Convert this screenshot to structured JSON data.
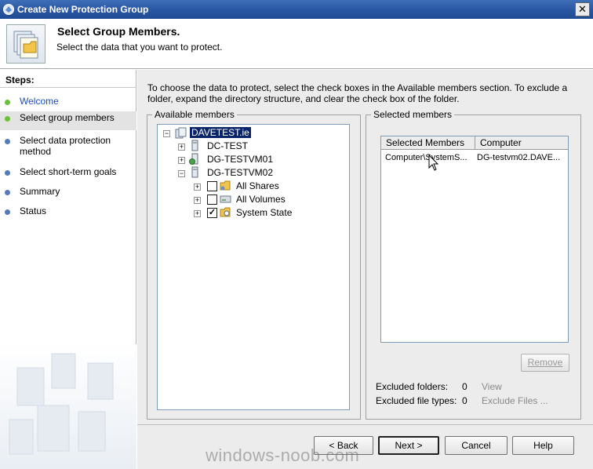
{
  "window": {
    "title": "Create New Protection Group",
    "close_glyph": "✕"
  },
  "header": {
    "title": "Select Group Members.",
    "subtitle": "Select the data that you want to protect."
  },
  "steps": {
    "title": "Steps:",
    "items": [
      {
        "label": "Welcome",
        "state": "link"
      },
      {
        "label": "Select group members",
        "state": "current"
      },
      {
        "label": "Select data protection method",
        "state": "pending"
      },
      {
        "label": "Select short-term goals",
        "state": "pending"
      },
      {
        "label": "Summary",
        "state": "pending"
      },
      {
        "label": "Status",
        "state": "pending"
      }
    ]
  },
  "instructions": "To choose the data to protect, select the check boxes in the Available members section. To exclude a folder, expand the directory structure, and clear the check box of the folder.",
  "available": {
    "title": "Available members",
    "tree": {
      "root": "DAVETEST.ie",
      "servers": [
        {
          "name": "DC-TEST"
        },
        {
          "name": "DG-TESTVM01"
        },
        {
          "name": "DG-TESTVM02"
        }
      ],
      "children_of_vm02": [
        {
          "name": "All Shares",
          "checked": false
        },
        {
          "name": "All Volumes",
          "checked": false
        },
        {
          "name": "System State",
          "checked": true
        }
      ]
    }
  },
  "selected": {
    "title": "Selected members",
    "columns": [
      "Selected Members",
      "Computer"
    ],
    "rows": [
      {
        "member": "Computer\\SystemS...",
        "computer": "DG-testvm02.DAVE..."
      }
    ],
    "remove_label": "Remove"
  },
  "exclusions": {
    "folders_label": "Excluded folders:",
    "folders_count": "0",
    "folders_link": "View",
    "filetypes_label": "Excluded file types:",
    "filetypes_count": "0",
    "filetypes_link": "Exclude Files ..."
  },
  "buttons": {
    "back": "< Back",
    "next": "Next >",
    "cancel": "Cancel",
    "help": "Help"
  },
  "watermark": "windows-noob.com",
  "colors": {
    "title_bar": "#2b58a4",
    "selection": "#0a246a",
    "step_dot": "#6cbf3a",
    "link": "#1a4fb5"
  }
}
